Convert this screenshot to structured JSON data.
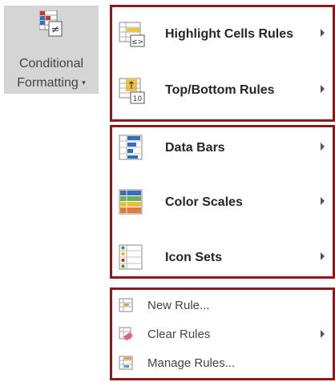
{
  "ribbon": {
    "button_label_line1": "Conditional",
    "button_label_line2": "Formatting",
    "caret": "▾",
    "icon": "conditional-formatting-icon"
  },
  "menu": {
    "groups": [
      {
        "items": [
          {
            "label": "Highlight Cells Rules",
            "icon": "highlight-cells-rules-icon",
            "submenu": true
          },
          {
            "label": "Top/Bottom Rules",
            "icon": "top-bottom-rules-icon",
            "submenu": true
          }
        ]
      },
      {
        "items": [
          {
            "label": "Data Bars",
            "icon": "data-bars-icon",
            "submenu": true
          },
          {
            "label": "Color Scales",
            "icon": "color-scales-icon",
            "submenu": true
          },
          {
            "label": "Icon Sets",
            "icon": "icon-sets-icon",
            "submenu": true
          }
        ]
      },
      {
        "items": [
          {
            "label": "New Rule...",
            "icon": "new-rule-icon",
            "submenu": false
          },
          {
            "label": "Clear Rules",
            "icon": "clear-rules-icon",
            "submenu": true
          },
          {
            "label": "Manage Rules...",
            "icon": "manage-rules-icon",
            "submenu": false
          }
        ]
      }
    ]
  },
  "icon_text": {
    "highlight_badge": "≤>",
    "top_bottom_badge": "10",
    "top_bottom_arrow": "↑",
    "ribbon_badge": "≠"
  },
  "colors": {
    "group_border": "#8b1a1a",
    "ribbon_bg": "#d5d5d5"
  }
}
